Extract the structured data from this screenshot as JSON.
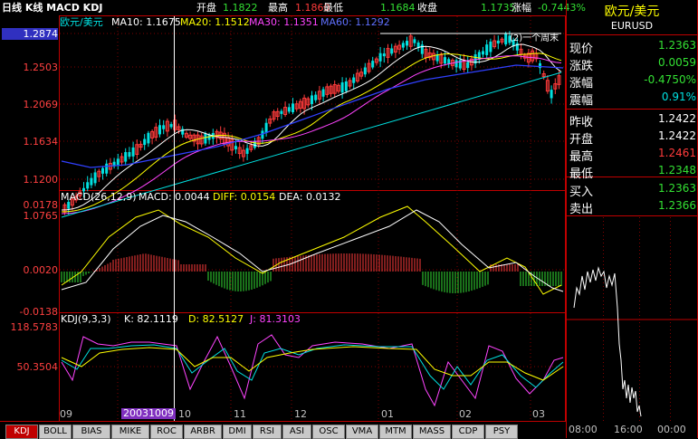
{
  "header": {
    "title": "日线 K线 MACD KDJ",
    "open_label": "开盘",
    "open_value": "1.1822",
    "high_label": "最高",
    "high_value": "1.1860",
    "low_label": "最低",
    "low_value": "1.1684",
    "close_label": "收盘",
    "close_value": "1.1735",
    "change_pct_label": "涨幅",
    "change_pct_value": "-0.7443%"
  },
  "main_chart": {
    "symbol": "欧元/美元",
    "ma10": "MA10: 1.1675",
    "ma20": "MA20: 1.1512",
    "ma30": "MA30: 1.1351",
    "ma60": "MA60: 1.1292",
    "y_labels": [
      "1.2874",
      "1.2503",
      "1.2069",
      "1.1634",
      "1.1200",
      "1.0765"
    ],
    "annotation": "(2)一个周末"
  },
  "macd_panel": {
    "label": "MACD(26,12,9)",
    "macd": "MACD: 0.0044",
    "diff": "DIFF: 0.0154",
    "dea": "DEA: 0.0132",
    "y_labels": [
      "0.0178",
      "0.0020",
      "-0.0138"
    ]
  },
  "kdj_panel": {
    "label": "KDJ(9,3,3)",
    "k": "K: 82.1119",
    "d": "D: 82.5127",
    "j": "J: 81.3103",
    "y_labels": [
      "118.5783",
      "50.3504"
    ]
  },
  "x_axis": {
    "labels": [
      "09",
      "10",
      "11",
      "12",
      "01",
      "02",
      "03"
    ],
    "cursor_date": "20031009"
  },
  "tabs": [
    "KDJ",
    "BOLL",
    "BIAS",
    "MIKE",
    "ROC",
    "ARBR",
    "DMI",
    "RSI",
    "ASI",
    "OSC",
    "VMA",
    "MTM",
    "MASS",
    "CDP",
    "PSY"
  ],
  "active_tab": "KDJ",
  "quote_panel": {
    "name": "欧元/美元",
    "code": "EURUSD",
    "rows": [
      {
        "label": "现价",
        "value": "1.2363",
        "color": "#33e033"
      },
      {
        "label": "涨跌",
        "value": "0.0059",
        "color": "#33e033"
      },
      {
        "label": "涨幅",
        "value": "-0.4750%",
        "color": "#33e033"
      },
      {
        "label": "震幅",
        "value": "0.91%",
        "color": "#00e0e0"
      },
      {
        "label": "昨收",
        "value": "1.2422",
        "color": "#ffffff"
      },
      {
        "label": "开盘",
        "value": "1.2422",
        "color": "#ffffff"
      },
      {
        "label": "最高",
        "value": "1.2461",
        "color": "#ff3b3b"
      },
      {
        "label": "最低",
        "value": "1.2348",
        "color": "#33e033"
      },
      {
        "label": "买入",
        "value": "1.2363",
        "color": "#33e033"
      },
      {
        "label": "卖出",
        "value": "1.2366",
        "color": "#33e033"
      }
    ],
    "time_labels": [
      "08:00",
      "16:00",
      "00:00"
    ]
  },
  "colors": {
    "up": "#ff3b3b",
    "down": "#00e0e0",
    "ma10": "#ffffff",
    "ma20": "#ffff00",
    "ma30": "#ff44ff",
    "ma60": "#3040ff",
    "frame": "#c00000"
  }
}
